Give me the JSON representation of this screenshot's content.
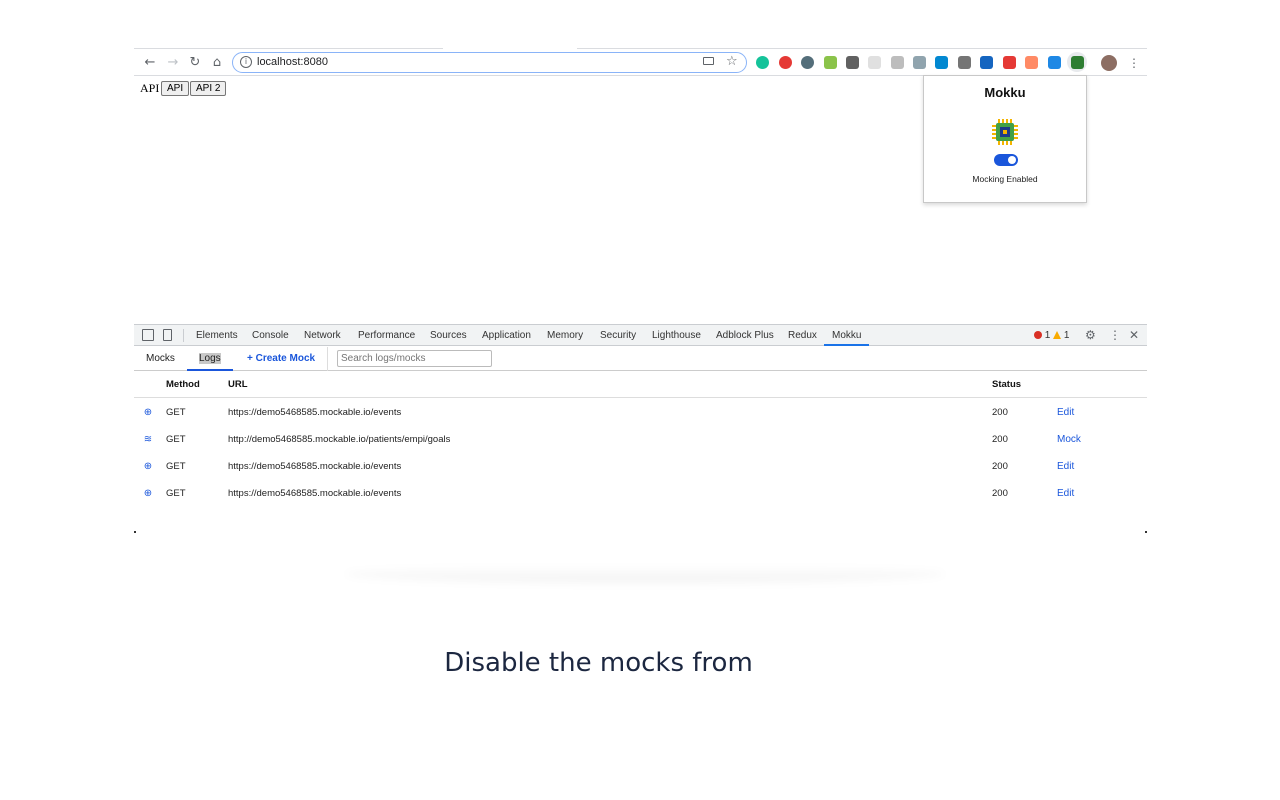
{
  "browser": {
    "address": "localhost:8080",
    "nav_icons": [
      "back-arrow-icon",
      "forward-arrow-icon",
      "reload-icon",
      "home-icon"
    ],
    "extension_icons": [
      {
        "name": "grammarly-icon",
        "color": "#15c39a"
      },
      {
        "name": "adblock-plus-icon",
        "color": "#e53935"
      },
      {
        "name": "news-icon",
        "color": "#546e7a"
      },
      {
        "name": "inbox-icon",
        "color": "#8bc34a"
      },
      {
        "name": "eyedropper-icon",
        "color": "#616161"
      },
      {
        "name": "blank-extension-icon",
        "color": "#e0e0e0"
      },
      {
        "name": "clock-icon",
        "color": "#bdbdbd"
      },
      {
        "name": "compass-icon",
        "color": "#90a4ae"
      },
      {
        "name": "docker-icon",
        "color": "#0288d1"
      },
      {
        "name": "drive-icon",
        "color": "#757575"
      },
      {
        "name": "bookmark-icon",
        "color": "#1565c0"
      },
      {
        "name": "youtube-icon",
        "color": "#e53935"
      },
      {
        "name": "face-icon",
        "color": "#ff8a65"
      },
      {
        "name": "edit-note-icon",
        "color": "#1e88e5"
      },
      {
        "name": "mokku-icon",
        "color": "#2e7d32"
      }
    ]
  },
  "page": {
    "text": "API",
    "buttons": [
      "API",
      "API 2"
    ]
  },
  "popup": {
    "title": "Mokku",
    "toggle_label": "Mocking Enabled",
    "toggle_on": true,
    "accent": "#1a56db"
  },
  "devtools": {
    "tabs": [
      "Elements",
      "Console",
      "Network",
      "Performance",
      "Sources",
      "Application",
      "Memory",
      "Security",
      "Lighthouse",
      "Adblock Plus",
      "Redux",
      "Mokku"
    ],
    "active_tab": "Mokku",
    "errors": "1",
    "warnings": "1",
    "mokku": {
      "tabs": [
        "Mocks",
        "Logs"
      ],
      "active_tab": "Logs",
      "create_label": "+ Create Mock",
      "search_placeholder": "Search logs/mocks",
      "columns": [
        "Method",
        "URL",
        "Status"
      ],
      "rows": [
        {
          "icon": "mocked-chip-icon",
          "method": "GET",
          "url": "https://demo5468585.mockable.io/events",
          "status": "200",
          "action": "Edit"
        },
        {
          "icon": "network-wifi-icon",
          "method": "GET",
          "url": "http://demo5468585.mockable.io/patients/empi/goals",
          "status": "200",
          "action": "Mock"
        },
        {
          "icon": "mocked-chip-icon",
          "method": "GET",
          "url": "https://demo5468585.mockable.io/events",
          "status": "200",
          "action": "Edit"
        },
        {
          "icon": "mocked-chip-icon",
          "method": "GET",
          "url": "https://demo5468585.mockable.io/events",
          "status": "200",
          "action": "Edit"
        }
      ]
    }
  },
  "caption": "Disable the mocks from"
}
